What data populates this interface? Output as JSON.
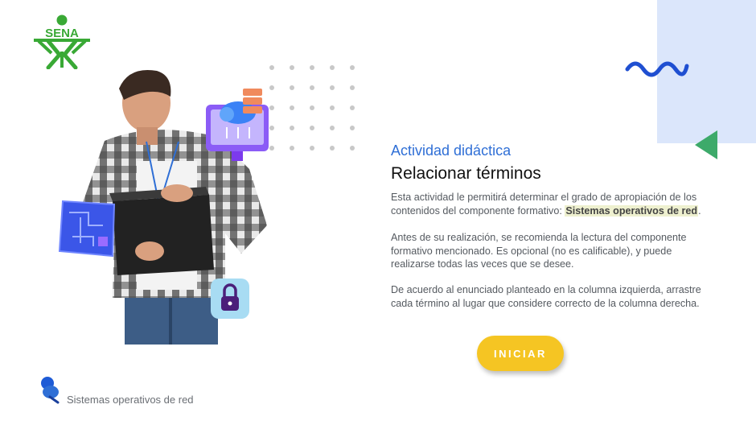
{
  "logo": {
    "text": "SENA",
    "color": "#39a935"
  },
  "activity": {
    "subtitle": "Actividad didáctica",
    "title": "Relacionar términos",
    "paragraph1_before": "Esta actividad le permitirá determinar el grado de apropiación de los contenidos del componente formativo: ",
    "paragraph1_highlight": "Sistemas operativos de red",
    "paragraph1_after": ".",
    "paragraph2": "Antes de su realización, se recomienda la lectura del componente formativo mencionado.  Es opcional (no es calificable), y puede realizarse todas las veces que se desee.",
    "paragraph3": "De acuerdo al enunciado planteado en la columna izquierda, arrastre cada término al lugar que considere correcto de la columna derecha."
  },
  "start_button": {
    "label": "INICIAR",
    "color": "#f5c523"
  },
  "footer": {
    "label": "Sistemas operativos de red"
  },
  "colors": {
    "accent_blue": "#2f6fd6",
    "deco_block": "#dbe6fb",
    "deco_triangle": "#3daa6a",
    "wave": "#1f4fd1"
  },
  "icons": [
    "sena-logo",
    "cloud-network-icon",
    "circuit-board-icon",
    "lock-icon",
    "pin-icon"
  ]
}
